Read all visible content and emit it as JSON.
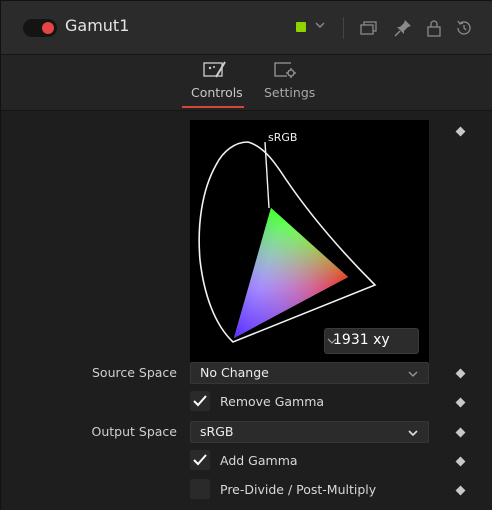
{
  "header": {
    "tool_name": "Gamut1",
    "color_swatch": "#8fd400",
    "toggle_color": "#e64545"
  },
  "tabs": [
    {
      "label": "Controls",
      "active": true
    },
    {
      "label": "Settings",
      "active": false
    }
  ],
  "gamut_view": {
    "colorspace_label": "sRGB",
    "diagram_select": "1931 xy"
  },
  "controls": {
    "source_space_label": "Source Space",
    "source_space_value": "No Change",
    "remove_gamma_label": "Remove Gamma",
    "remove_gamma_checked": true,
    "output_space_label": "Output Space",
    "output_space_value": "sRGB",
    "add_gamma_label": "Add Gamma",
    "add_gamma_checked": true,
    "pre_divide_label": "Pre-Divide / Post-Multiply",
    "pre_divide_checked": false
  },
  "accent_color": "#d8453a"
}
